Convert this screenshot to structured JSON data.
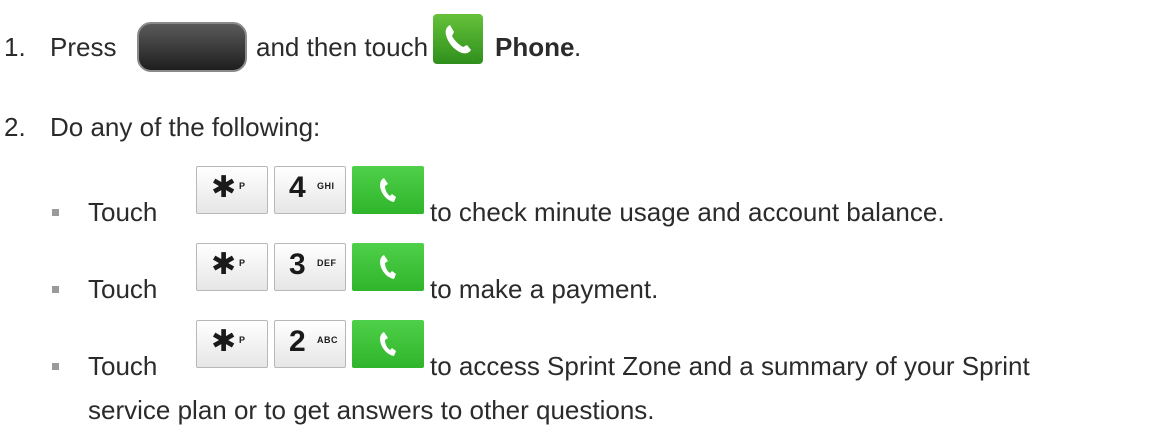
{
  "steps": [
    {
      "number": "1.",
      "text_before": "Press",
      "text_middle": "and then touch",
      "app_name": "Phone",
      "text_end": "."
    },
    {
      "number": "2.",
      "text": "Do any of the following:"
    }
  ],
  "bullets": [
    {
      "prefix": "Touch",
      "keys": [
        {
          "main": "✱",
          "sub": "P"
        },
        {
          "main": "4",
          "sub": "GHI"
        }
      ],
      "text": "to check minute usage and account balance."
    },
    {
      "prefix": "Touch",
      "keys": [
        {
          "main": "✱",
          "sub": "P"
        },
        {
          "main": "3",
          "sub": "DEF"
        }
      ],
      "text": "to make a payment."
    },
    {
      "prefix": "Touch",
      "keys": [
        {
          "main": "✱",
          "sub": "P"
        },
        {
          "main": "2",
          "sub": "ABC"
        }
      ],
      "text": "to access Sprint Zone and a summary of your Sprint",
      "text_continued": "service plan or to get answers to other questions."
    }
  ],
  "icons": {
    "home_key": "home-button-icon",
    "phone_app": "phone-app-icon",
    "call_key": "call-key-icon"
  }
}
